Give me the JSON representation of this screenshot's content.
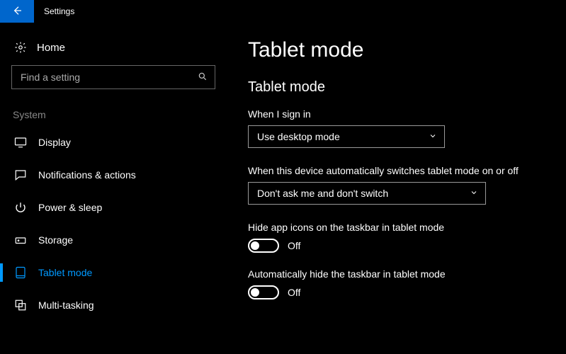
{
  "titlebar": {
    "title": "Settings"
  },
  "sidebar": {
    "home_label": "Home",
    "search_placeholder": "Find a setting",
    "group_label": "System",
    "items": [
      {
        "label": "Display"
      },
      {
        "label": "Notifications & actions"
      },
      {
        "label": "Power & sleep"
      },
      {
        "label": "Storage"
      },
      {
        "label": "Tablet mode"
      },
      {
        "label": "Multi-tasking"
      }
    ]
  },
  "main": {
    "page_title": "Tablet mode",
    "section_title": "Tablet mode",
    "signin": {
      "label": "When I sign in",
      "value": "Use desktop mode"
    },
    "autoswitch": {
      "label": "When this device automatically switches tablet mode on or off",
      "value": "Don't ask me and don't switch"
    },
    "hide_icons": {
      "label": "Hide app icons on the taskbar in tablet mode",
      "state": "Off"
    },
    "hide_taskbar": {
      "label": "Automatically hide the taskbar in tablet mode",
      "state": "Off"
    }
  }
}
